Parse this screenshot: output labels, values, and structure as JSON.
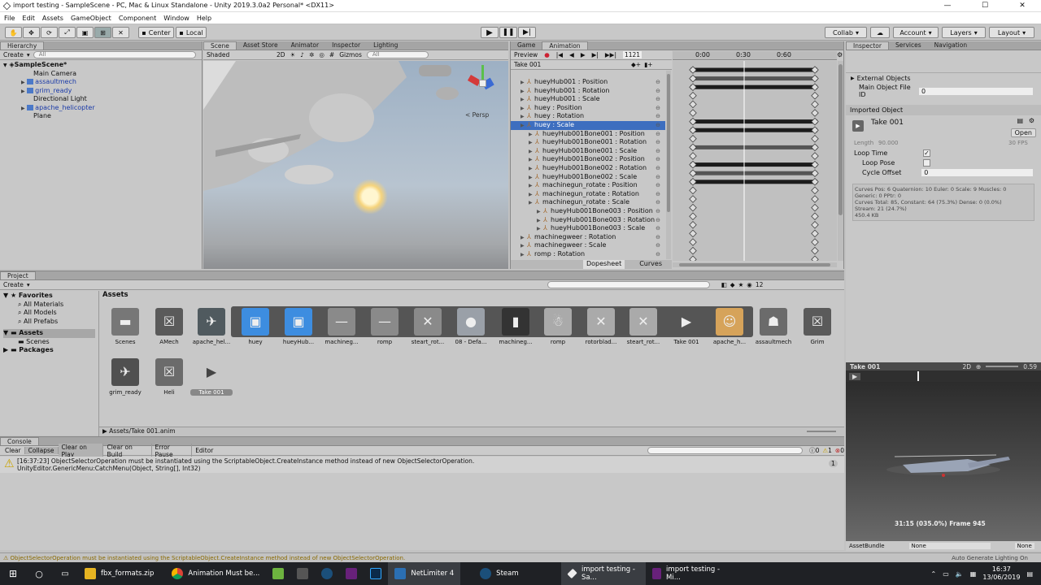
{
  "window": {
    "title": "import testing - SampleScene - PC, Mac & Linux Standalone - Unity 2019.3.0a2 Personal* <DX11>",
    "min": "—",
    "max": "☐",
    "close": "✕"
  },
  "menu": [
    "File",
    "Edit",
    "Assets",
    "GameObject",
    "Component",
    "Window",
    "Help"
  ],
  "toolbar": {
    "center": "Center",
    "local": "Local",
    "collab": "Collab",
    "account": "Account",
    "layers": "Layers",
    "layout": "Layout"
  },
  "hierarchy": {
    "tab": "Hierarchy",
    "create": "Create",
    "search": "All",
    "scene": "SampleScene*",
    "items": [
      "Main Camera",
      "assaultmech",
      "grim_ready",
      "Directional Light",
      "apache_helicopter",
      "Plane"
    ]
  },
  "scene": {
    "tabs": [
      "Scene",
      "Asset Store",
      "Animator",
      "Inspector",
      "Lighting"
    ],
    "shading": "Shaded",
    "mode2d": "2D",
    "gizmos": "Gizmos",
    "search": "All",
    "persp": "< Persp"
  },
  "animation": {
    "tabs": [
      "Game",
      "Animation"
    ],
    "preview": "Preview",
    "frame": "1121",
    "clip": "Take 001",
    "timeline": [
      "0:00",
      "0:30",
      "0:60"
    ],
    "props": [
      {
        "name": "hueyHub001 : Position",
        "indent": 0
      },
      {
        "name": "hueyHub001 : Rotation",
        "indent": 0
      },
      {
        "name": "hueyHub001 : Scale",
        "indent": 0
      },
      {
        "name": "huey : Position",
        "indent": 0
      },
      {
        "name": "huey : Rotation",
        "indent": 0
      },
      {
        "name": "huey : Scale",
        "indent": 0,
        "selected": true
      },
      {
        "name": "hueyHub001Bone001 : Position",
        "indent": 1
      },
      {
        "name": "hueyHub001Bone001 : Rotation",
        "indent": 1
      },
      {
        "name": "hueyHub001Bone001 : Scale",
        "indent": 1
      },
      {
        "name": "hueyHub001Bone002 : Position",
        "indent": 1
      },
      {
        "name": "hueyHub001Bone002 : Rotation",
        "indent": 1
      },
      {
        "name": "hueyHub001Bone002 : Scale",
        "indent": 1
      },
      {
        "name": "machinegun_rotate : Position",
        "indent": 1
      },
      {
        "name": "machinegun_rotate : Rotation",
        "indent": 1
      },
      {
        "name": "machinegun_rotate : Scale",
        "indent": 1
      },
      {
        "name": "hueyHub001Bone003 : Position",
        "indent": 2
      },
      {
        "name": "hueyHub001Bone003 : Rotation",
        "indent": 2
      },
      {
        "name": "hueyHub001Bone003 : Scale",
        "indent": 2
      },
      {
        "name": "machinegweer : Rotation",
        "indent": 0
      },
      {
        "name": "machinegweer : Scale",
        "indent": 0
      },
      {
        "name": "romp : Rotation",
        "indent": 0
      }
    ],
    "dopesheet": "Dopesheet",
    "curves": "Curves"
  },
  "inspector": {
    "tabs": [
      "Inspector",
      "Services",
      "Navigation"
    ],
    "external": "External Objects",
    "main_file_id_label": "Main Object File ID",
    "main_file_id": "0",
    "imported": "Imported Object",
    "clip": "Take 001",
    "open": "Open",
    "length_label": "Length",
    "length": "90.000",
    "fps": "30 FPS",
    "loop_time": "Loop Time",
    "loop_pose": "Loop Pose",
    "cycle_offset": "Cycle Offset",
    "cycle_value": "0",
    "stats": [
      "Curves Pos: 6 Quaternion: 10 Euler: 0 Scale: 9 Muscles: 0",
      "Generic: 0 PPtr: 0",
      "Curves Total: 85, Constant: 64 (75.3%) Dense: 0 (0.0%)",
      "Stream: 21 (24.7%)",
      "450.4 KB"
    ]
  },
  "preview": {
    "title": "Take 001",
    "mode2d": "2D",
    "speed": "0.59",
    "status": "31:15 (035.0%) Frame 945"
  },
  "assetbundle": {
    "label": "AssetBundle",
    "none1": "None",
    "none2": "None"
  },
  "project": {
    "tab": "Project",
    "create": "Create",
    "count": "12",
    "fav": "Favorites",
    "favItems": [
      "All Materials",
      "All Models",
      "All Prefabs"
    ],
    "assets": "Assets",
    "assetsSub": [
      "Scenes"
    ],
    "packages": "Packages",
    "heading": "Assets",
    "path": "Assets/Take 001.anim",
    "items1": [
      "Scenes",
      "AMech",
      "apache_hel...",
      "huey",
      "hueyHub...",
      "machineg...",
      "romp",
      "steart_rot...",
      "08 - Defa...",
      "machineg...",
      "romp",
      "rotorblad...",
      "steart_rot...",
      "Take 001",
      "apache_h...",
      "assaultmech",
      "Grim"
    ],
    "items2": [
      "grim_ready",
      "Heli",
      "Take 001"
    ]
  },
  "console": {
    "tab": "Console",
    "buttons": [
      "Clear",
      "Collapse",
      "Clear on Play",
      "Clear on Build",
      "Error Pause",
      "Editor"
    ],
    "c0": "0",
    "c1": "1",
    "c2": "0",
    "msg1": "[16:37:23] ObjectSelectorOperation must be instantiated using the ScriptableObject.CreateInstance method instead of new ObjectSelectorOperation.",
    "msg2": "UnityEditor.GenericMenu:CatchMenu(Object, String[], Int32)",
    "count": "1"
  },
  "status": {
    "msg": "ObjectSelectorOperation must be instantiated using the ScriptableObject.CreateInstance method instead of new ObjectSelectorOperation.",
    "lighting": "Auto Generate Lighting On"
  },
  "taskbar": {
    "items": [
      "fbx_formats.zip",
      "Animation Must be...",
      "NetLimiter 4",
      "Steam",
      "import testing - Sa...",
      "import testing - Mi..."
    ],
    "time": "16:37",
    "date": "13/06/2019"
  }
}
